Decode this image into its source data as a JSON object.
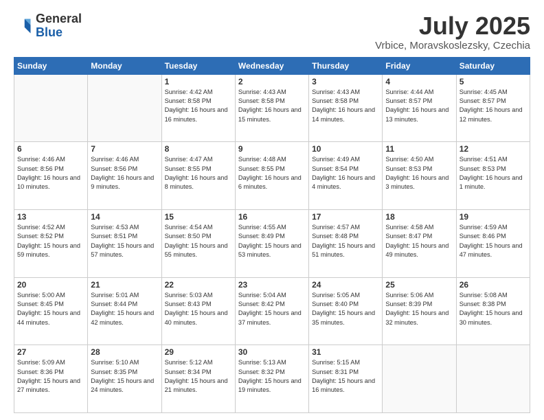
{
  "header": {
    "logo_general": "General",
    "logo_blue": "Blue",
    "month_title": "July 2025",
    "location": "Vrbice, Moravskoslezsky, Czechia"
  },
  "days_of_week": [
    "Sunday",
    "Monday",
    "Tuesday",
    "Wednesday",
    "Thursday",
    "Friday",
    "Saturday"
  ],
  "weeks": [
    [
      {
        "day": "",
        "info": ""
      },
      {
        "day": "",
        "info": ""
      },
      {
        "day": "1",
        "info": "Sunrise: 4:42 AM\nSunset: 8:58 PM\nDaylight: 16 hours and 16 minutes."
      },
      {
        "day": "2",
        "info": "Sunrise: 4:43 AM\nSunset: 8:58 PM\nDaylight: 16 hours and 15 minutes."
      },
      {
        "day": "3",
        "info": "Sunrise: 4:43 AM\nSunset: 8:58 PM\nDaylight: 16 hours and 14 minutes."
      },
      {
        "day": "4",
        "info": "Sunrise: 4:44 AM\nSunset: 8:57 PM\nDaylight: 16 hours and 13 minutes."
      },
      {
        "day": "5",
        "info": "Sunrise: 4:45 AM\nSunset: 8:57 PM\nDaylight: 16 hours and 12 minutes."
      }
    ],
    [
      {
        "day": "6",
        "info": "Sunrise: 4:46 AM\nSunset: 8:56 PM\nDaylight: 16 hours and 10 minutes."
      },
      {
        "day": "7",
        "info": "Sunrise: 4:46 AM\nSunset: 8:56 PM\nDaylight: 16 hours and 9 minutes."
      },
      {
        "day": "8",
        "info": "Sunrise: 4:47 AM\nSunset: 8:55 PM\nDaylight: 16 hours and 8 minutes."
      },
      {
        "day": "9",
        "info": "Sunrise: 4:48 AM\nSunset: 8:55 PM\nDaylight: 16 hours and 6 minutes."
      },
      {
        "day": "10",
        "info": "Sunrise: 4:49 AM\nSunset: 8:54 PM\nDaylight: 16 hours and 4 minutes."
      },
      {
        "day": "11",
        "info": "Sunrise: 4:50 AM\nSunset: 8:53 PM\nDaylight: 16 hours and 3 minutes."
      },
      {
        "day": "12",
        "info": "Sunrise: 4:51 AM\nSunset: 8:53 PM\nDaylight: 16 hours and 1 minute."
      }
    ],
    [
      {
        "day": "13",
        "info": "Sunrise: 4:52 AM\nSunset: 8:52 PM\nDaylight: 15 hours and 59 minutes."
      },
      {
        "day": "14",
        "info": "Sunrise: 4:53 AM\nSunset: 8:51 PM\nDaylight: 15 hours and 57 minutes."
      },
      {
        "day": "15",
        "info": "Sunrise: 4:54 AM\nSunset: 8:50 PM\nDaylight: 15 hours and 55 minutes."
      },
      {
        "day": "16",
        "info": "Sunrise: 4:55 AM\nSunset: 8:49 PM\nDaylight: 15 hours and 53 minutes."
      },
      {
        "day": "17",
        "info": "Sunrise: 4:57 AM\nSunset: 8:48 PM\nDaylight: 15 hours and 51 minutes."
      },
      {
        "day": "18",
        "info": "Sunrise: 4:58 AM\nSunset: 8:47 PM\nDaylight: 15 hours and 49 minutes."
      },
      {
        "day": "19",
        "info": "Sunrise: 4:59 AM\nSunset: 8:46 PM\nDaylight: 15 hours and 47 minutes."
      }
    ],
    [
      {
        "day": "20",
        "info": "Sunrise: 5:00 AM\nSunset: 8:45 PM\nDaylight: 15 hours and 44 minutes."
      },
      {
        "day": "21",
        "info": "Sunrise: 5:01 AM\nSunset: 8:44 PM\nDaylight: 15 hours and 42 minutes."
      },
      {
        "day": "22",
        "info": "Sunrise: 5:03 AM\nSunset: 8:43 PM\nDaylight: 15 hours and 40 minutes."
      },
      {
        "day": "23",
        "info": "Sunrise: 5:04 AM\nSunset: 8:42 PM\nDaylight: 15 hours and 37 minutes."
      },
      {
        "day": "24",
        "info": "Sunrise: 5:05 AM\nSunset: 8:40 PM\nDaylight: 15 hours and 35 minutes."
      },
      {
        "day": "25",
        "info": "Sunrise: 5:06 AM\nSunset: 8:39 PM\nDaylight: 15 hours and 32 minutes."
      },
      {
        "day": "26",
        "info": "Sunrise: 5:08 AM\nSunset: 8:38 PM\nDaylight: 15 hours and 30 minutes."
      }
    ],
    [
      {
        "day": "27",
        "info": "Sunrise: 5:09 AM\nSunset: 8:36 PM\nDaylight: 15 hours and 27 minutes."
      },
      {
        "day": "28",
        "info": "Sunrise: 5:10 AM\nSunset: 8:35 PM\nDaylight: 15 hours and 24 minutes."
      },
      {
        "day": "29",
        "info": "Sunrise: 5:12 AM\nSunset: 8:34 PM\nDaylight: 15 hours and 21 minutes."
      },
      {
        "day": "30",
        "info": "Sunrise: 5:13 AM\nSunset: 8:32 PM\nDaylight: 15 hours and 19 minutes."
      },
      {
        "day": "31",
        "info": "Sunrise: 5:15 AM\nSunset: 8:31 PM\nDaylight: 15 hours and 16 minutes."
      },
      {
        "day": "",
        "info": ""
      },
      {
        "day": "",
        "info": ""
      }
    ]
  ]
}
